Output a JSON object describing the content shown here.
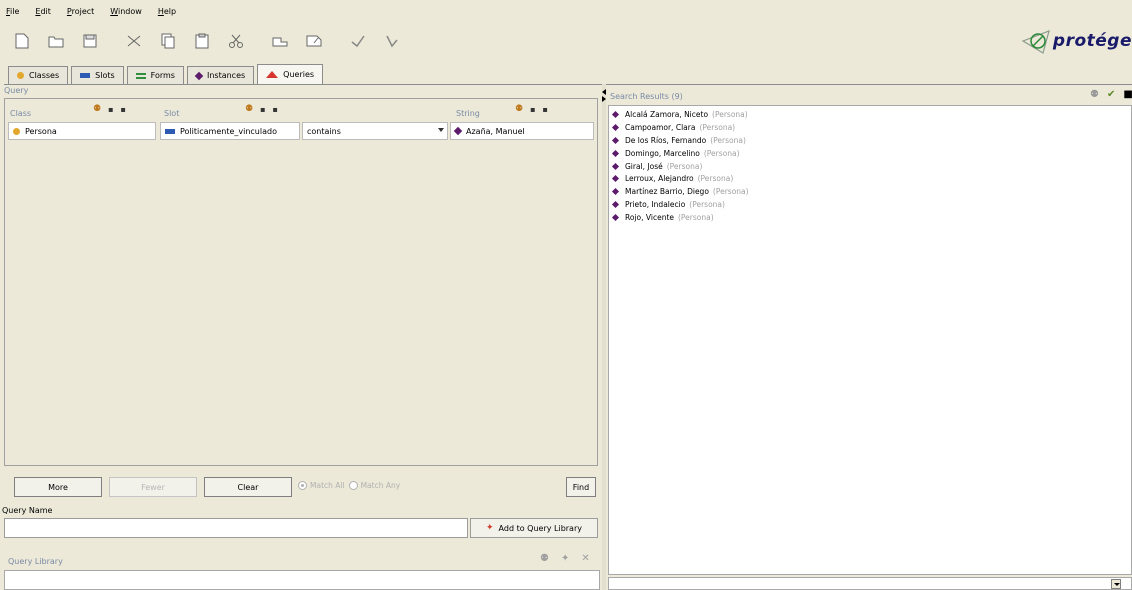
{
  "menu": [
    "File",
    "Edit",
    "Project",
    "Window",
    "Help"
  ],
  "toolbar": {
    "icons": [
      "new-file-icon",
      "open-folder-icon",
      "save-icon",
      "cut-icon",
      "copy-icon",
      "paste-icon",
      "scissors-icon",
      "undo-icon",
      "redo-icon",
      "forward-icon",
      "back-icon"
    ],
    "logo_text": "protége"
  },
  "tabs": [
    {
      "label": "Classes",
      "icon": "class-icon"
    },
    {
      "label": "Slots",
      "icon": "slot-icon"
    },
    {
      "label": "Forms",
      "icon": "form-icon"
    },
    {
      "label": "Instances",
      "icon": "instance-icon"
    },
    {
      "label": "Queries",
      "icon": "query-icon",
      "active": true
    }
  ],
  "query": {
    "title": "Query",
    "headers": {
      "class": "Class",
      "slot": "Slot",
      "string": "String"
    },
    "class_value": "Persona",
    "slot_value": "Politicamente_vinculado",
    "operator_value": "contains",
    "string_value": "Azaña, Manuel",
    "buttons": {
      "more": "More",
      "fewer": "Fewer",
      "clear": "Clear",
      "find": "Find"
    },
    "match_all": "Match All",
    "match_any": "Match Any"
  },
  "query_name": {
    "label": "Query Name",
    "value": "",
    "add_button": "Add to Query Library"
  },
  "query_library": {
    "title": "Query Library"
  },
  "search_results": {
    "title": "Search Results (9)",
    "items": [
      {
        "name": "Alcalá Zamora, Niceto",
        "class": "(Persona)"
      },
      {
        "name": "Campoamor, Clara",
        "class": "(Persona)"
      },
      {
        "name": "De los Ríos, Fernando",
        "class": "(Persona)"
      },
      {
        "name": "Domingo, Marcelino",
        "class": "(Persona)"
      },
      {
        "name": "Giral, José",
        "class": "(Persona)"
      },
      {
        "name": "Lerroux, Alejandro",
        "class": "(Persona)"
      },
      {
        "name": "Martínez Barrio, Diego",
        "class": "(Persona)"
      },
      {
        "name": "Prieto, Indalecio",
        "class": "(Persona)"
      },
      {
        "name": "Rojo, Vicente",
        "class": "(Persona)"
      }
    ]
  },
  "colors": {
    "accent": "#7a8aa6",
    "instance": "#5c1b6b",
    "class": "#e2a72e",
    "slot": "#2d5bb4"
  }
}
